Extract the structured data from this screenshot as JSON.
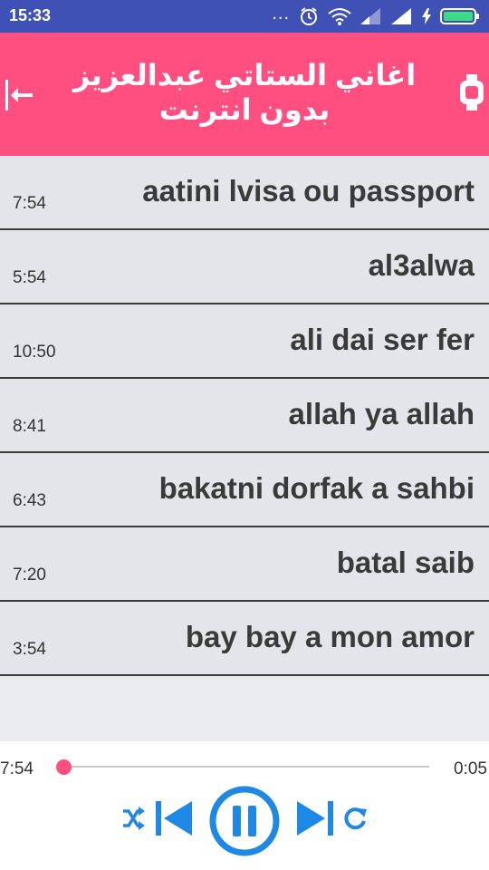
{
  "status_bar": {
    "time": "15:33",
    "dots": "...",
    "icons": [
      "alarm-icon",
      "wifi-icon",
      "signal-icon",
      "signal-icon",
      "charging-icon",
      "battery-icon"
    ]
  },
  "header": {
    "title": "اغاني الستاتي عبدالعزيز بدون انترنت",
    "left_icon": "back-arrow-icon",
    "right_icon": "watch-icon"
  },
  "songs": [
    {
      "name": "aatini lvisa ou passport",
      "duration": "7:54"
    },
    {
      "name": "al3alwa",
      "duration": "5:54"
    },
    {
      "name": "ali dai ser fer",
      "duration": "10:50"
    },
    {
      "name": "allah ya allah",
      "duration": "8:41"
    },
    {
      "name": "bakatni dorfak a sahbi",
      "duration": "6:43"
    },
    {
      "name": "batal saib",
      "duration": "7:20"
    },
    {
      "name": "bay bay a mon amor",
      "duration": "3:54"
    }
  ],
  "player": {
    "elapsed": "7:54",
    "remaining": "0:05",
    "progress": 0.01,
    "controls": [
      "shuffle-icon",
      "previous-icon",
      "pause-icon",
      "next-icon",
      "repeat-icon"
    ],
    "accent": "#1e88e5"
  },
  "colors": {
    "status_bar": "#3f51b5",
    "header": "#ff4f81",
    "list_bg": "#e4e5ea"
  }
}
